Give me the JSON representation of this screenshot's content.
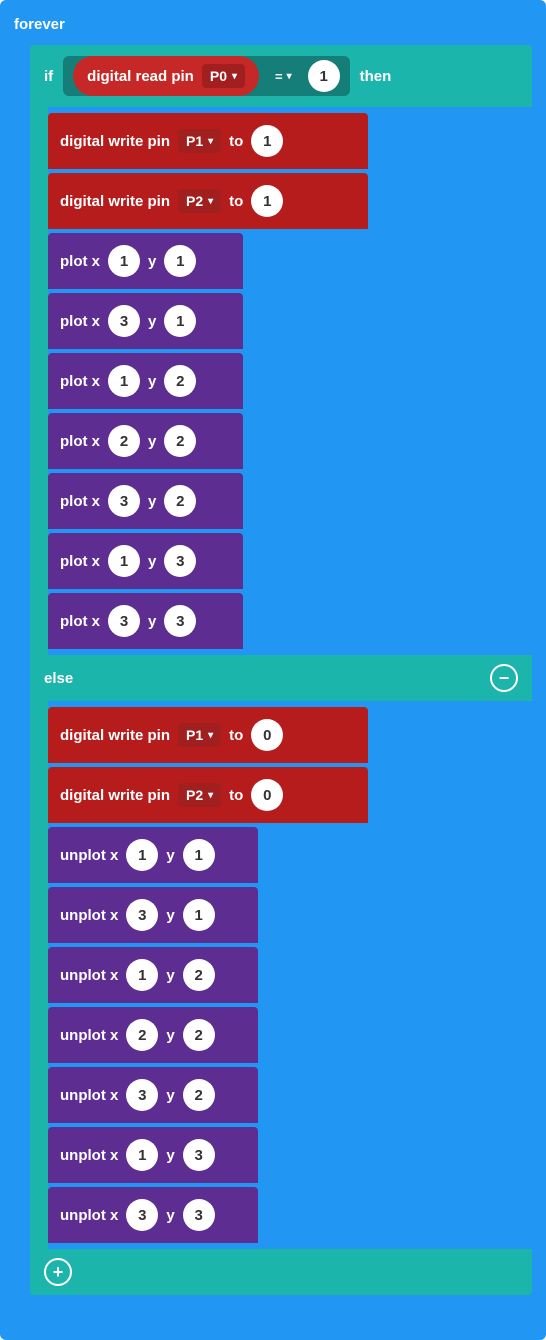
{
  "forever": {
    "label": "forever"
  },
  "if_block": {
    "if_kw": "if",
    "then_kw": "then",
    "else_kw": "else",
    "condition": {
      "read_label": "digital read pin",
      "read_pin": "P0",
      "op": "=",
      "rhs": "1"
    },
    "then_branch": {
      "dw": [
        {
          "label": "digital write pin",
          "pin": "P1",
          "to": "to",
          "val": "1"
        },
        {
          "label": "digital write pin",
          "pin": "P2",
          "to": "to",
          "val": "1"
        }
      ],
      "plot_label": "plot x",
      "y_label": "y",
      "plots": [
        {
          "x": "1",
          "y": "1"
        },
        {
          "x": "3",
          "y": "1"
        },
        {
          "x": "1",
          "y": "2"
        },
        {
          "x": "2",
          "y": "2"
        },
        {
          "x": "3",
          "y": "2"
        },
        {
          "x": "1",
          "y": "3"
        },
        {
          "x": "3",
          "y": "3"
        }
      ]
    },
    "else_branch": {
      "dw": [
        {
          "label": "digital write pin",
          "pin": "P1",
          "to": "to",
          "val": "0"
        },
        {
          "label": "digital write pin",
          "pin": "P2",
          "to": "to",
          "val": "0"
        }
      ],
      "unplot_label": "unplot x",
      "y_label": "y",
      "unplots": [
        {
          "x": "1",
          "y": "1"
        },
        {
          "x": "3",
          "y": "1"
        },
        {
          "x": "1",
          "y": "2"
        },
        {
          "x": "2",
          "y": "2"
        },
        {
          "x": "3",
          "y": "2"
        },
        {
          "x": "1",
          "y": "3"
        },
        {
          "x": "3",
          "y": "3"
        }
      ]
    }
  },
  "icons": {
    "minus": "⊖",
    "plus": "⊕",
    "caret": "▾"
  }
}
